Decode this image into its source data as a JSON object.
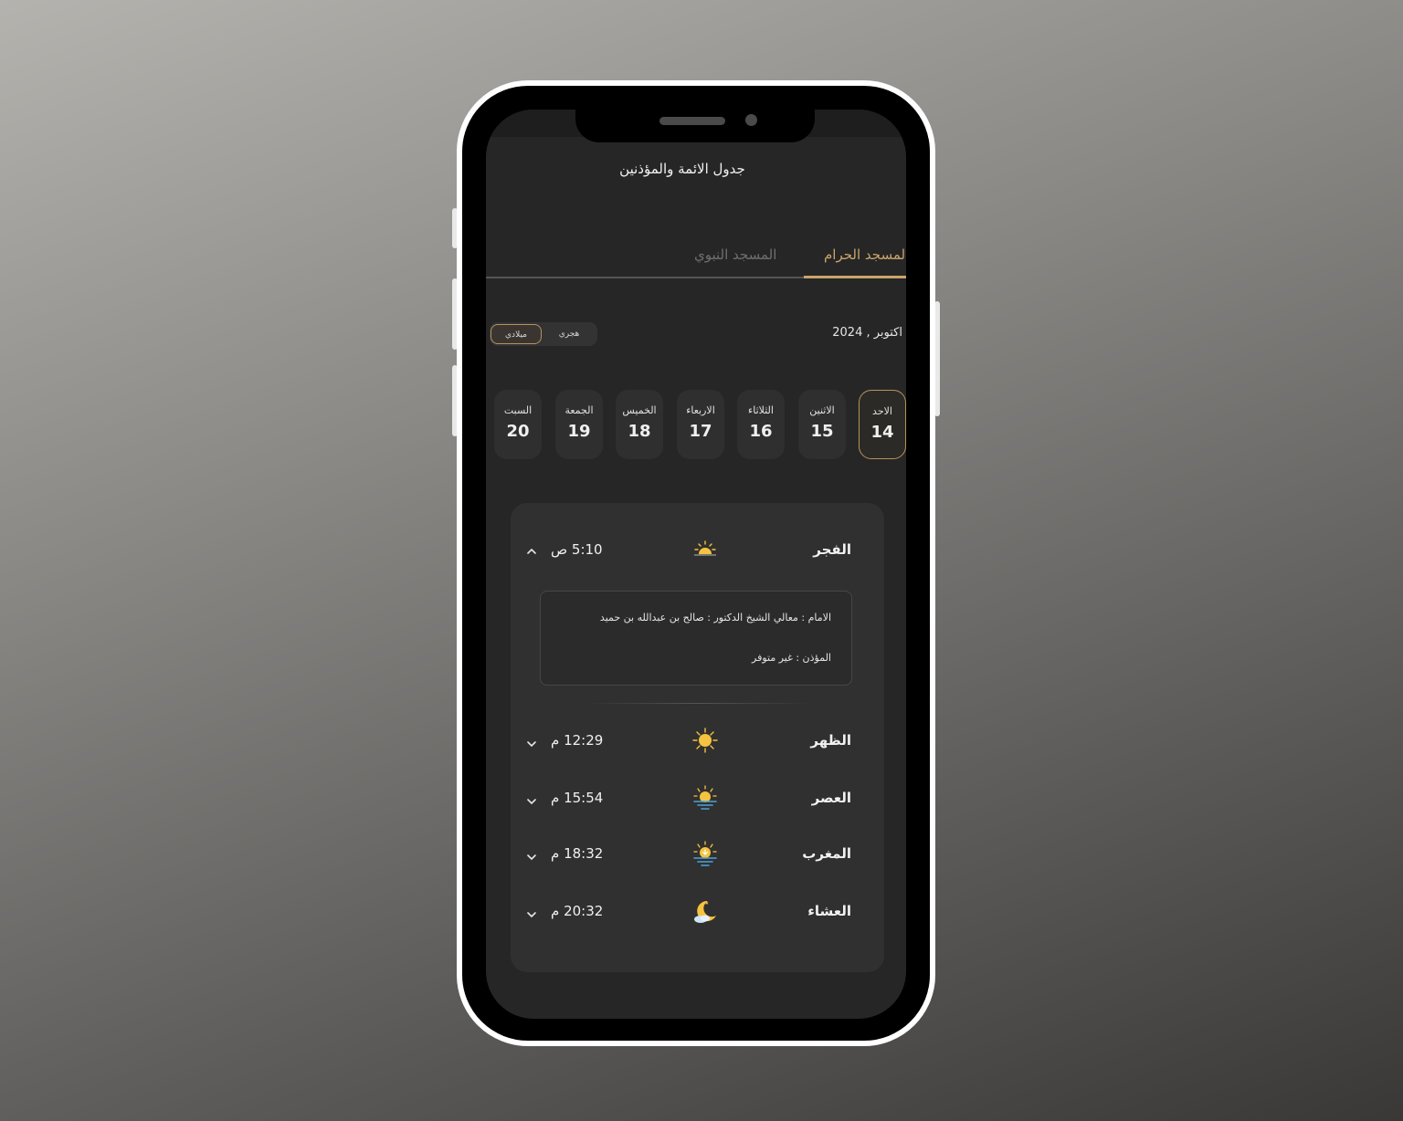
{
  "app": {
    "title": "جدول الائمة والمؤذنين"
  },
  "tabs": [
    {
      "label": "المسجد الحرام",
      "active": true
    },
    {
      "label": "المسجد النبوي",
      "active": false
    }
  ],
  "calendar": {
    "month_label": "اكتوبر , 2024",
    "toggle": {
      "selected": "ميلادي",
      "other": "هجري"
    },
    "days": [
      {
        "name": "الاحد",
        "num": "14",
        "selected": true
      },
      {
        "name": "الاثنين",
        "num": "15"
      },
      {
        "name": "الثلاثاء",
        "num": "16"
      },
      {
        "name": "الاربعاء",
        "num": "17"
      },
      {
        "name": "الخميس",
        "num": "18"
      },
      {
        "name": "الجمعة",
        "num": "19"
      },
      {
        "name": "السبت",
        "num": "20"
      }
    ]
  },
  "prayers": [
    {
      "name": "الفجر",
      "time": "5:10 ص",
      "icon": "sunrise-icon",
      "expanded": true
    },
    {
      "name": "الظهر",
      "time": "12:29 م",
      "icon": "sun-icon"
    },
    {
      "name": "العصر",
      "time": "15:54 م",
      "icon": "sun-over-water-icon"
    },
    {
      "name": "المغرب",
      "time": "18:32 م",
      "icon": "sunset-icon"
    },
    {
      "name": "العشاء",
      "time": "20:32 م",
      "icon": "moon-cloud-icon"
    }
  ],
  "detail": {
    "imam": "الامام : معالي الشيخ الدكتور : صالح بن عبدالله بن حميد",
    "muazzin": "المؤذن : غير متوفر"
  },
  "colors": {
    "accent": "#c9a56a",
    "background": "#262626",
    "card": "#303030",
    "sun": "#f6c340",
    "water": "#4aa3d8"
  }
}
